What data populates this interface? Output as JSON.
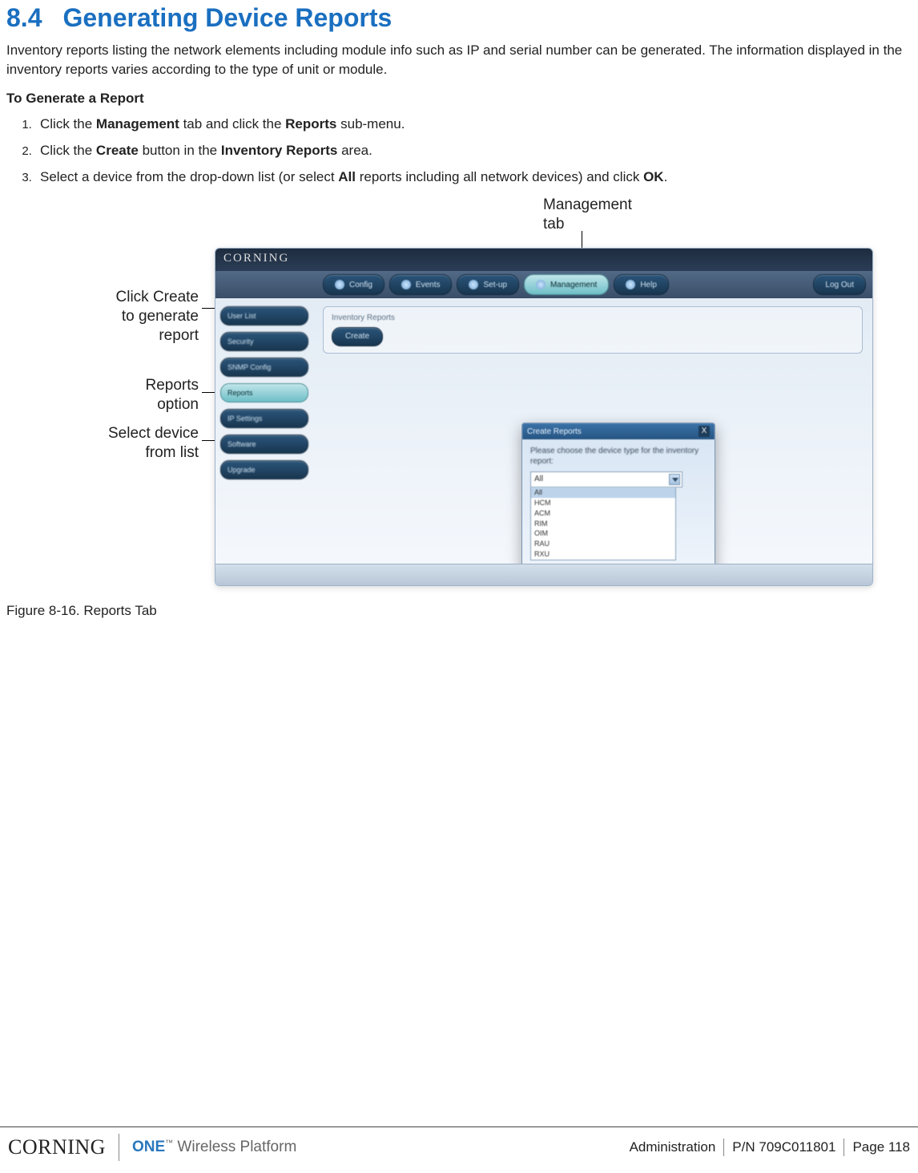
{
  "heading": {
    "number": "8.4",
    "title": "Generating Device Reports"
  },
  "intro": "Inventory reports listing the network elements including module info such as IP and serial number can be generated. The information displayed in the inventory reports varies according to the type of unit or module.",
  "subheading": "To Generate a Report",
  "steps": {
    "s1a": "Click the ",
    "s1b": "Management",
    "s1c": " tab and click the ",
    "s1d": "Reports",
    "s1e": " sub-menu.",
    "s2a": "Click the ",
    "s2b": "Create",
    "s2c": " button in the ",
    "s2d": "Inventory Reports",
    "s2e": " area.",
    "s3a": "Select a device from the drop-down list (or select ",
    "s3b": "All",
    "s3c": " reports including all network devices) and click ",
    "s3d": "OK",
    "s3e": "."
  },
  "callouts": {
    "top": "Management\ntab",
    "c1": "Click Create\nto generate\nreport",
    "c2": "Reports\noption",
    "c3": "Select device\nfrom list"
  },
  "app": {
    "title": "CORNING",
    "toolbar": {
      "t1": "Config",
      "t2": "Events",
      "t3": "Set-up",
      "t4": "Management",
      "t5": "Help",
      "logout": "Log Out"
    },
    "side": {
      "m1": "User List",
      "m2": "Security",
      "m3": "SNMP Config",
      "m4": "Reports",
      "m5": "IP Settings",
      "m6": "Software",
      "m7": "Upgrade"
    },
    "group": {
      "title": "Inventory Reports",
      "create": "Create"
    },
    "dialog": {
      "title": "Create Reports",
      "prompt": "Please choose the device type for the inventory report:",
      "selected": "All",
      "options": {
        "o0": "All",
        "o1": "HCM",
        "o2": "ACM",
        "o3": "RIM",
        "o4": "OIM",
        "o5": "RAU",
        "o6": "RXU"
      }
    }
  },
  "caption": "Figure 8-16. Reports Tab",
  "footer": {
    "brand": "CORNING",
    "prod_one": "ONE",
    "prod_tm": "™",
    "prod_rest": " Wireless Platform",
    "section": "Administration",
    "pn": "P/N 709C011801",
    "page": "Page 118"
  }
}
